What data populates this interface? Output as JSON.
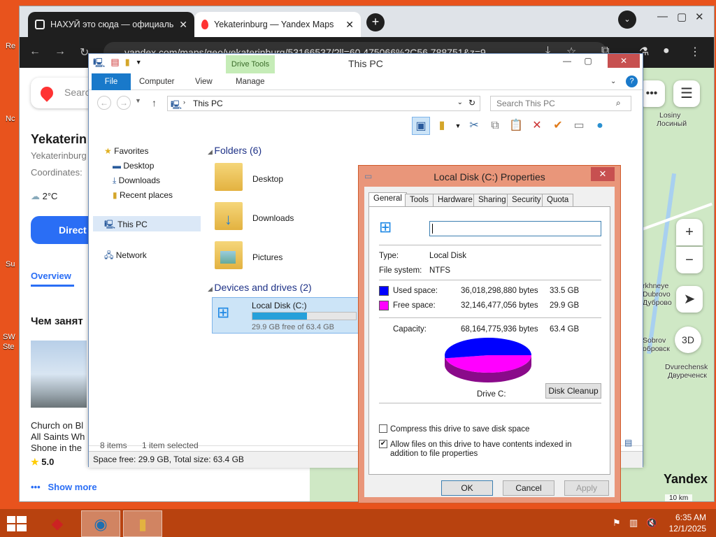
{
  "desktop": {
    "icon_labels": [
      "Re",
      "Nc",
      "Su",
      "SW",
      "Ste"
    ]
  },
  "browser": {
    "tabs": [
      {
        "label": "НАХУЙ это сюда — официаль",
        "active": false
      },
      {
        "label": "Yekaterinburg — Yandex Maps",
        "active": true
      }
    ],
    "url": "yandex.com/maps/geo/yekaterinburg/53166537/?ll=60.475066%2C56.788751&z=9"
  },
  "yandex": {
    "search_placeholder": "Searc",
    "title": "Yekaterin",
    "subtitle": "Yekaterinburg",
    "coordinates_label": "Coordinates:",
    "weather": "2°C",
    "directions_label": "Direct",
    "overview_tab": "Overview",
    "section_title": "Чем занят",
    "card_lines": [
      "Church on Bl",
      "All Saints Wh",
      "Shone in the"
    ],
    "rating": "5.0",
    "show_more": "Show more",
    "map_labels": [
      "Losiny",
      "Лосиный",
      "rkhneye",
      "Dubrovo",
      "Дуброво",
      "Sobrov",
      "обровск",
      "Dvurechensk",
      "Двуреченск"
    ],
    "logo": "Yandex",
    "scale": "10 km",
    "btn_3d": "3D"
  },
  "explorer": {
    "title": "This PC",
    "contextual_tab": "Drive Tools",
    "tabs": [
      "File",
      "Computer",
      "View",
      "Manage"
    ],
    "address": "This PC",
    "search_placeholder": "Search This PC",
    "nav": [
      "Favorites",
      "Desktop",
      "Downloads",
      "Recent places",
      "This PC",
      "Network"
    ],
    "folders_header": "Folders (6)",
    "folders": [
      "Desktop",
      "Downloads",
      "Pictures"
    ],
    "devices_header": "Devices and drives (2)",
    "drive_name": "Local Disk (C:)",
    "drive_free": "29.9 GB free of 63.4 GB",
    "drive_used_fraction": 0.53,
    "status_items": "8 items",
    "status_selected": "1 item selected",
    "status_space": "Space free: 29.9 GB, Total size: 63.4 GB"
  },
  "properties": {
    "title": "Local Disk (C:) Properties",
    "tabs": [
      "General",
      "Tools",
      "Hardware",
      "Sharing",
      "Security",
      "Quota"
    ],
    "name_value": "",
    "type_label": "Type:",
    "type_value": "Local Disk",
    "fs_label": "File system:",
    "fs_value": "NTFS",
    "used_label": "Used space:",
    "used_bytes": "36,018,298,880 bytes",
    "used_gb": "33.5 GB",
    "free_label": "Free space:",
    "free_bytes": "32,146,477,056 bytes",
    "free_gb": "29.9 GB",
    "cap_label": "Capacity:",
    "cap_bytes": "68,164,775,936 bytes",
    "cap_gb": "63.4 GB",
    "drive_label": "Drive C:",
    "cleanup": "Disk Cleanup",
    "compress_label": "Compress this drive to save disk space",
    "index_label": "Allow files on this drive to have contents indexed in addition to file properties",
    "compress_checked": false,
    "index_checked": true,
    "ok": "OK",
    "cancel": "Cancel",
    "apply": "Apply",
    "colors": {
      "used": "#0000ff",
      "free": "#ff00ff"
    }
  },
  "taskbar": {
    "time": "6:35 AM",
    "date": "12/1/2025"
  }
}
